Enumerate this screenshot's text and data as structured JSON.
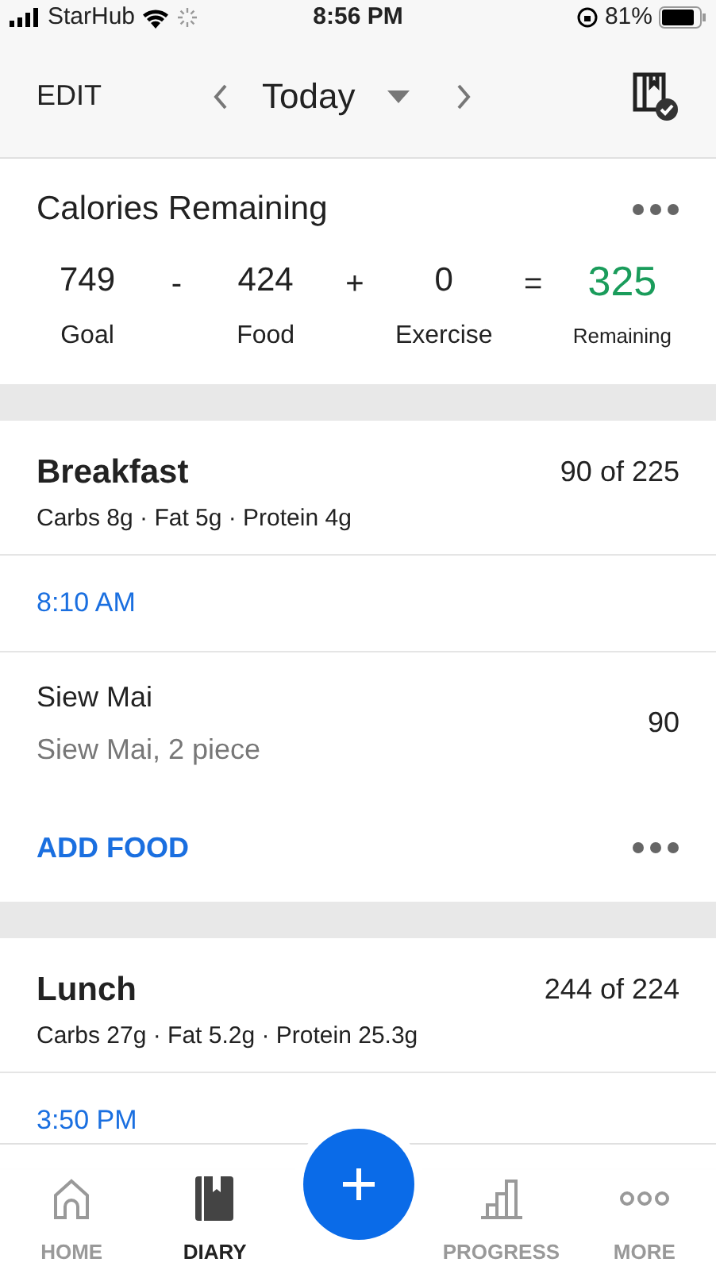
{
  "status_bar": {
    "carrier": "StarHub",
    "time": "8:56 PM",
    "battery": "81%"
  },
  "header": {
    "edit": "EDIT",
    "date": "Today"
  },
  "summary": {
    "title": "Calories Remaining",
    "items": [
      {
        "kind": "value",
        "value": "749",
        "label": "Goal"
      },
      {
        "kind": "operator",
        "value": "-"
      },
      {
        "kind": "value",
        "value": "424",
        "label": "Food"
      },
      {
        "kind": "operator",
        "value": "+"
      },
      {
        "kind": "value",
        "value": "0",
        "label": "Exercise"
      },
      {
        "kind": "operator",
        "value": "="
      },
      {
        "kind": "result",
        "value": "325",
        "label": "Remaining"
      }
    ]
  },
  "meals": [
    {
      "name": "Breakfast",
      "total": "90 of 225",
      "macros": "Carbs 8g · Fat 5g · Protein 4g",
      "time": "8:10 AM",
      "foods": [
        {
          "name": "Siew Mai",
          "detail": "Siew Mai, 2 piece",
          "calories": "90"
        }
      ],
      "add": "ADD FOOD"
    },
    {
      "name": "Lunch",
      "total": "244 of 224",
      "macros": "Carbs 27g · Fat 5.2g · Protein 25.3g",
      "time": "3:50 PM"
    }
  ],
  "tabs": [
    {
      "label": "HOME",
      "kind": "home",
      "selected": false
    },
    {
      "label": "DIARY",
      "kind": "diary",
      "selected": true
    },
    {
      "kind": "add"
    },
    {
      "label": "PROGRESS",
      "kind": "progress",
      "selected": false
    },
    {
      "label": "MORE",
      "kind": "more",
      "selected": false
    }
  ]
}
